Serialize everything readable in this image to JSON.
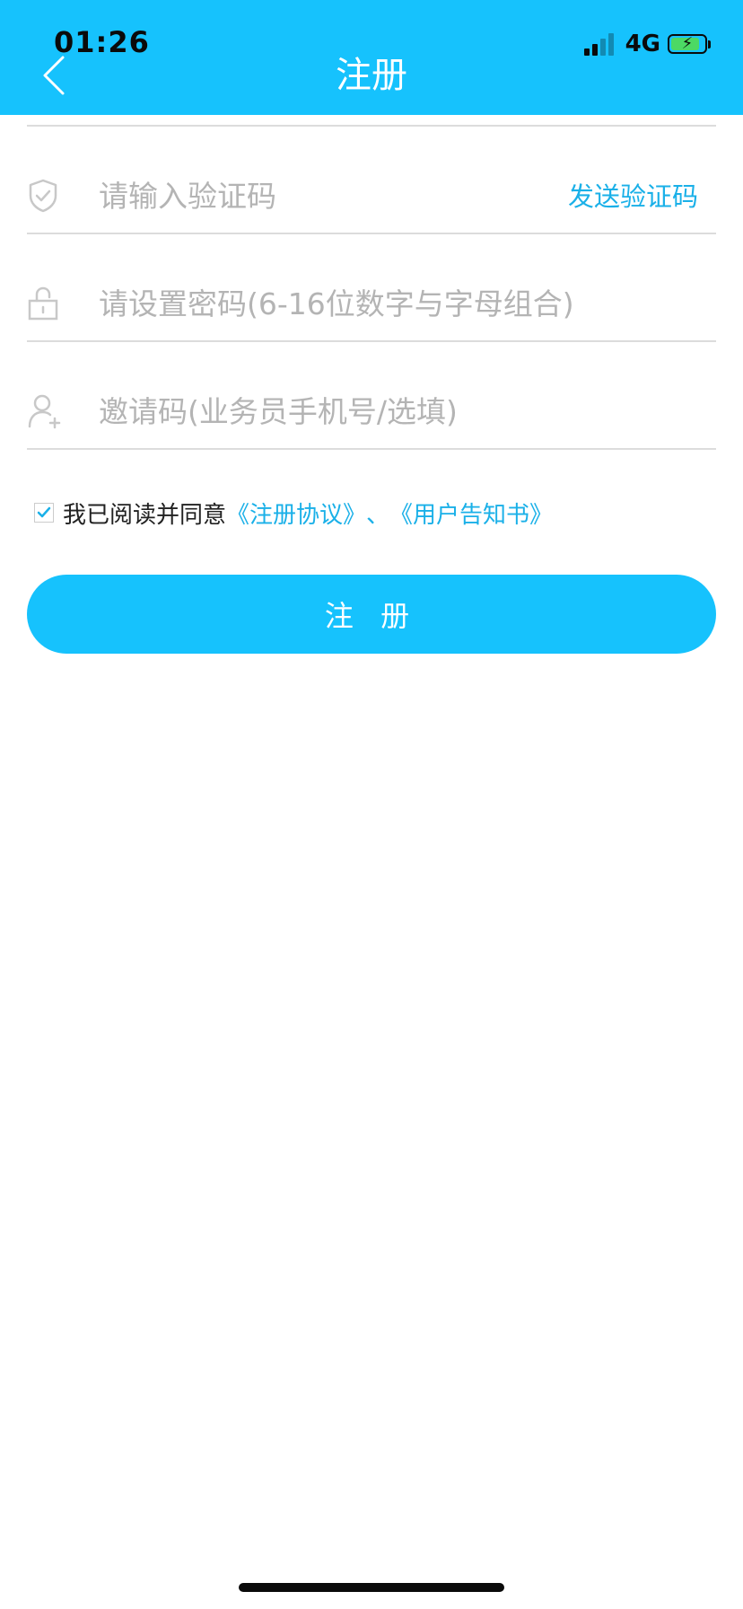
{
  "status_bar": {
    "time": "01:26",
    "network": "4G",
    "signal_bars_active": 2,
    "signal_bars_total": 4,
    "battery_level": 0.85,
    "battery_charging": true
  },
  "header": {
    "title": "注册",
    "back_icon": "chevron-left-icon"
  },
  "form": {
    "verification_code": {
      "placeholder": "请输入验证码",
      "value": "",
      "icon": "shield-check-icon",
      "send_label": "发送验证码"
    },
    "password": {
      "placeholder": "请设置密码(6-16位数字与字母组合)",
      "value": "",
      "icon": "lock-icon"
    },
    "invite_code": {
      "placeholder": "邀请码(业务员手机号/选填)",
      "value": "",
      "icon": "user-add-icon"
    }
  },
  "agreement": {
    "checked": true,
    "text": "我已阅读并同意",
    "link_terms": "《注册协议》",
    "separator": "、",
    "link_notice": "《用户告知书》"
  },
  "submit": {
    "label": "注 册"
  },
  "colors": {
    "brand": "#16c2fd",
    "link": "#1ab0e8",
    "placeholder": "#b4b4b4",
    "divider": "#dcdcdc",
    "battery": "#4cd964"
  }
}
